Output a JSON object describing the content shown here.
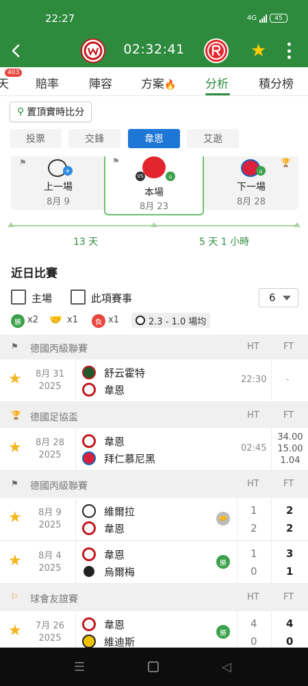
{
  "status_bar": {
    "time": "22:27",
    "net": "4G",
    "battery": "45"
  },
  "header": {
    "match_clock": "02:32:41",
    "colors": {
      "primary": "#2e8b3e",
      "star": "#ffcc00"
    }
  },
  "tabs": {
    "items": [
      {
        "label": "天",
        "badge": "403"
      },
      {
        "label": "賠率"
      },
      {
        "label": "陣容"
      },
      {
        "label": "方案"
      },
      {
        "label": "分析",
        "active": true
      },
      {
        "label": "積分榜"
      }
    ]
  },
  "pin_button": {
    "label": "置頂實時比分"
  },
  "subtabs": [
    "投票",
    "交鋒",
    "韋恩",
    "艾逖"
  ],
  "subtab_active": "韋恩",
  "fixtures": [
    {
      "label": "上一場",
      "date": "8月 9"
    },
    {
      "label": "本場",
      "date": "8月 23"
    },
    {
      "label": "下一場",
      "date": "8月 28"
    }
  ],
  "timeline": {
    "left": "13 天",
    "right": "5 天 1 小時"
  },
  "recent": {
    "title": "近日比賽",
    "filter_home": "主場",
    "filter_same": "此項賽事",
    "count": "6",
    "stats": {
      "win_label": "勝",
      "win": "x2",
      "draw": "x1",
      "loss_label": "負",
      "loss": "x1",
      "avg": "2.3 - 1.0 場均"
    }
  },
  "columns": {
    "ht": "HT",
    "ft": "FT"
  },
  "leagues": [
    {
      "name": "德國丙級聯賽",
      "matches": [
        {
          "date": "8月 31",
          "year": "2025",
          "home": "舒云霍特",
          "away": "韋恩",
          "time": "22:30",
          "ft": "-"
        }
      ]
    },
    {
      "name": "德國足協盃",
      "matches": [
        {
          "date": "8月 28",
          "year": "2025",
          "home": "韋恩",
          "away": "拜仁慕尼黑",
          "time": "02:45",
          "odds": [
            "34.00",
            "15.00",
            "1.04"
          ]
        }
      ]
    },
    {
      "name": "德國丙級聯賽",
      "matches": [
        {
          "date": "8月 9",
          "year": "2025",
          "home": "維爾拉",
          "away": "韋恩",
          "ht": [
            "1",
            "2"
          ],
          "ft": [
            "2",
            "2"
          ],
          "result": "draw"
        },
        {
          "date": "8月 4",
          "year": "2025",
          "home": "韋恩",
          "away": "烏爾梅",
          "ht": [
            "1",
            "0"
          ],
          "ft": [
            "3",
            "1"
          ],
          "result": "勝"
        }
      ]
    },
    {
      "name": "球會友誼賽",
      "matches": [
        {
          "date": "7月 26",
          "year": "2025",
          "home": "韋恩",
          "away": "維迪斯",
          "ht": [
            "4",
            "0"
          ],
          "ft": [
            "4",
            "0"
          ],
          "result": "勝"
        }
      ]
    }
  ]
}
